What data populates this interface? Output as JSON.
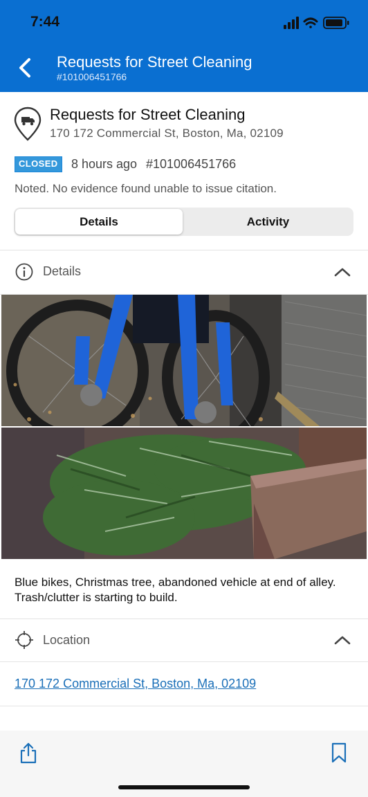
{
  "status_bar": {
    "time": "7:44"
  },
  "nav": {
    "title": "Requests for Street Cleaning",
    "subtitle": "#101006451766"
  },
  "request": {
    "title": "Requests for Street Cleaning",
    "address": "170 172 Commercial St, Boston, Ma, 02109",
    "status": "CLOSED",
    "time_ago": "8 hours ago",
    "id": "#101006451766",
    "note": "Noted. No evidence found unable to issue citation."
  },
  "tabs": [
    {
      "label": "Details",
      "active": true
    },
    {
      "label": "Activity",
      "active": false
    }
  ],
  "details_section": {
    "label": "Details",
    "icon": "info-icon",
    "expanded": true
  },
  "photos": [
    {
      "subject": "blue bikes"
    },
    {
      "subject": "christmas tree"
    }
  ],
  "description": "Blue bikes, Christmas tree, abandoned vehicle at end of alley. Trash/clutter is starting to build.",
  "location_section": {
    "label": "Location",
    "icon": "crosshair-icon",
    "expanded": true
  },
  "location_link": "170 172 Commercial St, Boston, Ma, 02109",
  "toolbar": {
    "share_icon": "share-icon",
    "bookmark_icon": "bookmark-icon"
  },
  "colors": {
    "header": "#0a6fd1",
    "badge": "#3498db",
    "link": "#1a6fb8"
  }
}
